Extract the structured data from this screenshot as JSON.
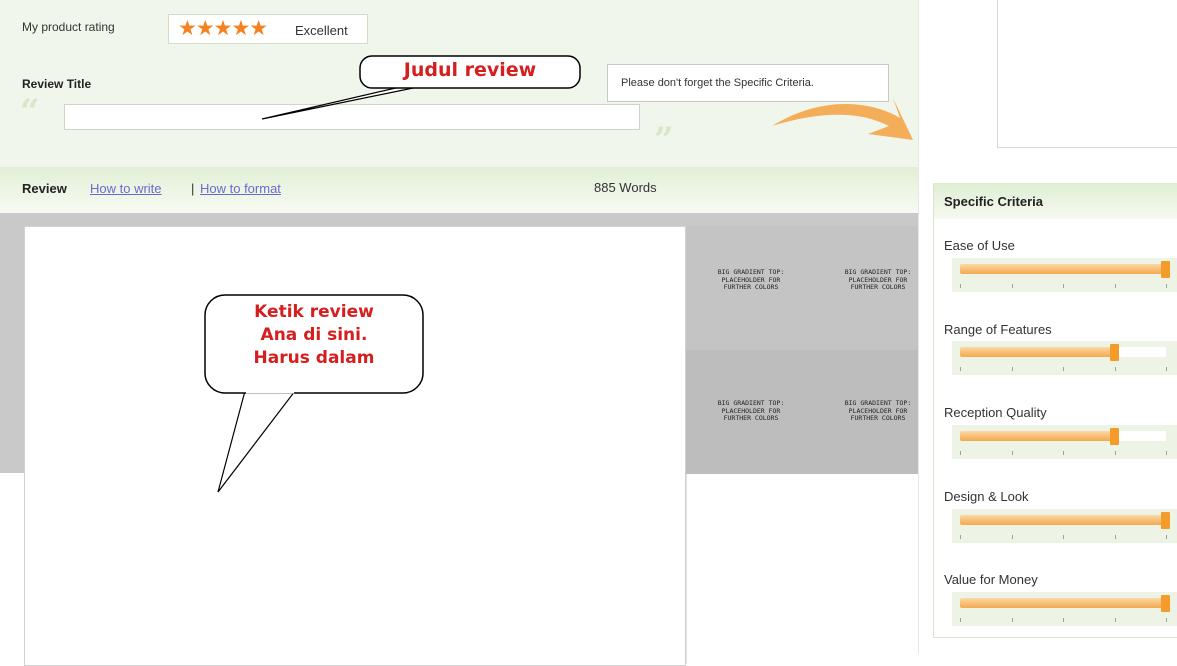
{
  "rating": {
    "label": "My product rating",
    "stars": "★★★★★",
    "text": "Excellent",
    "stars_filled": 5,
    "stars_total": 5
  },
  "review_title": {
    "label": "Review Title",
    "value": "",
    "open_quote": "“",
    "close_quote": "”",
    "hint": "Please don't forget the Specific Criteria."
  },
  "review_bar": {
    "label": "Review",
    "how_to_write": "How to write",
    "separator": "|",
    "how_to_format": "How to format",
    "word_count": "885 Words"
  },
  "placeholder_text": "BIG GRADIENT TOP:\nPLACEHOLDER FOR\nFURTHER COLORS",
  "criteria": {
    "title": "Specific Criteria",
    "items": [
      {
        "label": "Ease of Use",
        "level": 1.0
      },
      {
        "label": "Range of Features",
        "level": 0.75
      },
      {
        "label": "Reception Quality",
        "level": 0.75
      },
      {
        "label": "Design & Look",
        "level": 1.0
      },
      {
        "label": "Value for Money",
        "level": 1.0
      }
    ]
  },
  "annotations": {
    "title_callout": "Judul review",
    "review_callout": "Ketik review\nAna di sini.\nHarus dalam"
  },
  "colors": {
    "accent_orange": "#f58220",
    "annotation_red": "#d51f1f",
    "panel_green": "#f1f6ec",
    "link_purple": "#6a6acd"
  }
}
